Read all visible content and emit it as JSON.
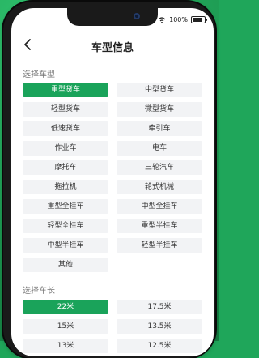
{
  "status": {
    "battery": "100%"
  },
  "header": {
    "title": "车型信息"
  },
  "vehicle_type_section": {
    "title": "选择车型",
    "options": [
      "重型货车",
      "中型货车",
      "轻型货车",
      "微型货车",
      "低速货车",
      "牵引车",
      "作业车",
      "电车",
      "摩托车",
      "三轮汽车",
      "拖拉机",
      "轮式机械",
      "重型全挂车",
      "中型全挂车",
      "轻型全挂车",
      "重型半挂车",
      "中型半挂车",
      "轻型半挂车",
      "其他"
    ],
    "selected": "重型货车"
  },
  "length_section": {
    "title": "选择车长",
    "options": [
      "22米",
      "17.5米",
      "15米",
      "13.5米",
      "13米",
      "12.5米"
    ],
    "selected": "22米"
  },
  "colors": {
    "accent": "#1aa35a",
    "background": "#1fa65a"
  },
  "icons": {
    "back": "back-arrow-icon",
    "wifi": "wifi-icon",
    "signal": "signal-icon"
  }
}
